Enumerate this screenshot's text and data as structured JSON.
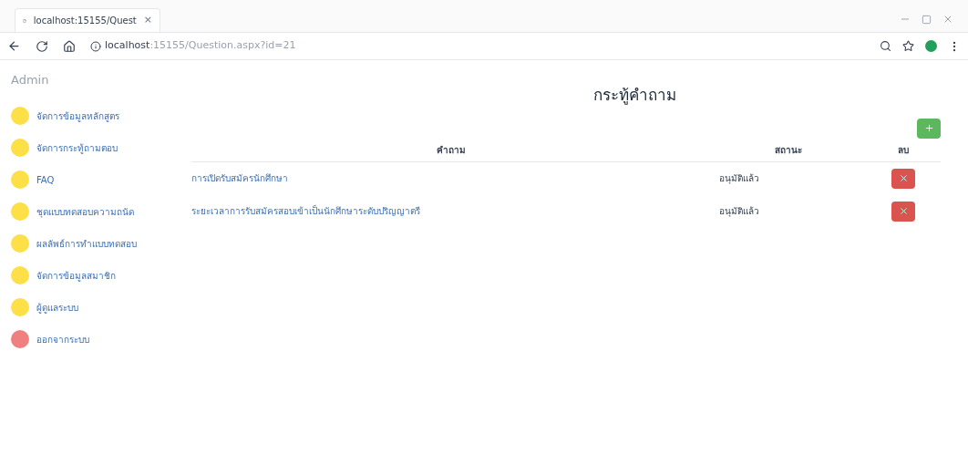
{
  "browser": {
    "tab_title": "localhost:15155/Quest",
    "tab_close": "×",
    "url_host": "localhost",
    "url_path": ":15155/Question.aspx?id=21"
  },
  "sidebar": {
    "title": "Admin",
    "items": [
      {
        "label": "จัดการข้อมูลหลักสูตร",
        "color": "#fde047"
      },
      {
        "label": "จัดการกระทู้ถามตอบ",
        "color": "#fde047"
      },
      {
        "label": "FAQ",
        "color": "#fde047"
      },
      {
        "label": "ชุดแบบทดสอบความถนัด",
        "color": "#fde047"
      },
      {
        "label": "ผลลัพธ์การทำแบบทดสอบ",
        "color": "#fde047"
      },
      {
        "label": "จัดการข้อมูลสมาชิก",
        "color": "#fde047"
      },
      {
        "label": "ผู้ดูแลระบบ",
        "color": "#fde047"
      },
      {
        "label": "ออกจากระบบ",
        "color": "#f08080"
      }
    ]
  },
  "main": {
    "title": "กระทู้คำถาม",
    "table": {
      "columns": [
        "คำถาม",
        "สถานะ",
        "ลบ"
      ],
      "rows": [
        {
          "question": "การเปิดรับสมัครนักศึกษา",
          "status": "อนุมัติแล้ว"
        },
        {
          "question": "ระยะเวลาการรับสมัครสอบเข้าเป็นนักศึกษาระดับปริญญาตรี",
          "status": "อนุมัติแล้ว"
        }
      ]
    }
  }
}
